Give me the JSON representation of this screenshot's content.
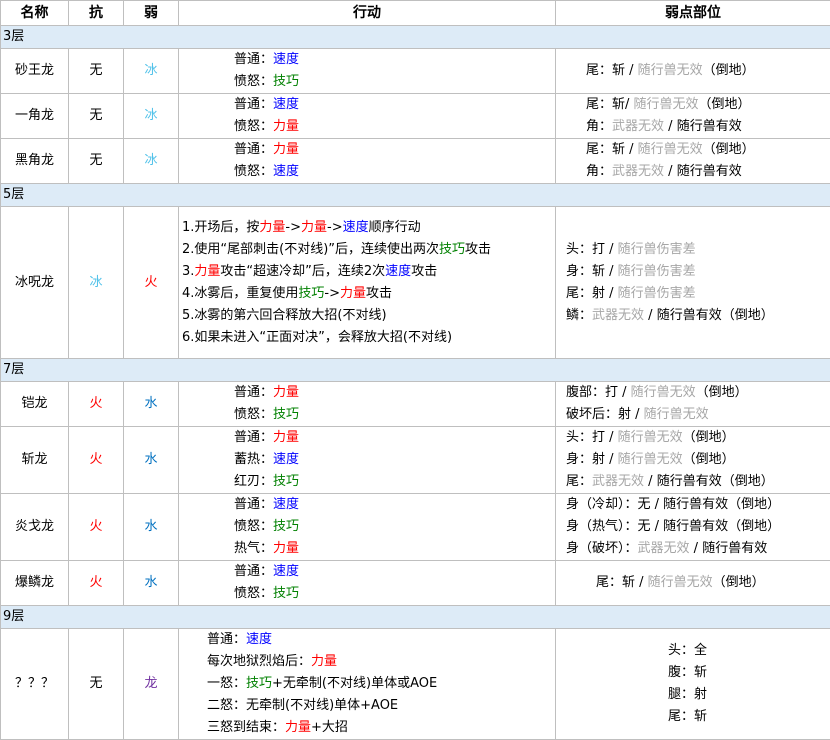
{
  "headers": {
    "name": "名称",
    "resist": "抗",
    "weak": "弱",
    "action": "行动",
    "weak_part": "弱点部位"
  },
  "floors": {
    "f3": "3层",
    "f5": "5层",
    "f7": "7层",
    "f9": "9层"
  },
  "terms": {
    "normal": "普通：",
    "angry": "愤怒：",
    "heat": "蓄热：",
    "red_blade": "红刃：",
    "hot": "热气：",
    "speed": "速度",
    "skill": "技巧",
    "power": "力量",
    "none": "无",
    "fire": "火",
    "ice": "冰",
    "water": "水",
    "dragon": "龙",
    "slash": "斩",
    "hit": "打",
    "shot": "射",
    "pet_invalid": "随行兽无效",
    "pet_valid": "随行兽有效",
    "pet_low": "随行兽伤害差",
    "weapon_invalid": "武器无效",
    "down": "（倒地）",
    "slash_colon": "斩 / "
  },
  "rows": {
    "r1": {
      "name": "砂王龙",
      "p1a": "尾：斩 / "
    },
    "r2": {
      "name": "一角龙",
      "p1a": "尾：斩/ ",
      "p2a": "角："
    },
    "r3": {
      "name": "黑角龙",
      "p1a": "尾：斩 / ",
      "p2a": "角："
    },
    "r4": {
      "name": "冰呪龙",
      "a1": "1.开场后，按",
      "a1b": "->",
      "a1c": "->",
      "a1d": "顺序行动",
      "a2": "2.使用“尾部刺击(不对线)”后，连续使出两次",
      "a2b": "攻击",
      "a3": "3.",
      "a3b": "攻击“超速冷却”后，连续2次",
      "a3c": "攻击",
      "a4": "4.冰雾后，重复使用",
      "a4b": "->",
      "a4c": "攻击",
      "a5": "5.冰雾的第六回合释放大招(不对线)",
      "a6": "6.如果未进入“正面对决”，会释放大招(不对线)",
      "p1": "头：打 / ",
      "p2": "身：斩 / ",
      "p3": "尾：射 / ",
      "p4": "鳞："
    },
    "r5": {
      "name": "铠龙",
      "p1": "腹部：打 / ",
      "p2": "破坏后：射 / "
    },
    "r6": {
      "name": "斩龙",
      "p1": "头：打 / ",
      "p2": "身：射 / ",
      "p3": "尾："
    },
    "r7": {
      "name": "炎戈龙",
      "p1": "身（冷却）：无 / ",
      "p2": "身（热气）：无 / ",
      "p3": "身（破坏）："
    },
    "r8": {
      "name": "爆鳞龙",
      "p1": "尾：斩 / "
    },
    "r9": {
      "name": "？？？",
      "a1": "普通：",
      "a2": "每次地狱烈焰后：",
      "a3": "一怒：",
      "a3b": "+无牵制(不对线)单体或AOE",
      "a4": "二怒：无牵制(不对线)单体+AOE",
      "a5": "三怒到结束：",
      "a5b": "+大招",
      "p1": "头：全",
      "p2": "腹：斩",
      "p3": "腿：射",
      "p4": "尾：斩"
    }
  }
}
